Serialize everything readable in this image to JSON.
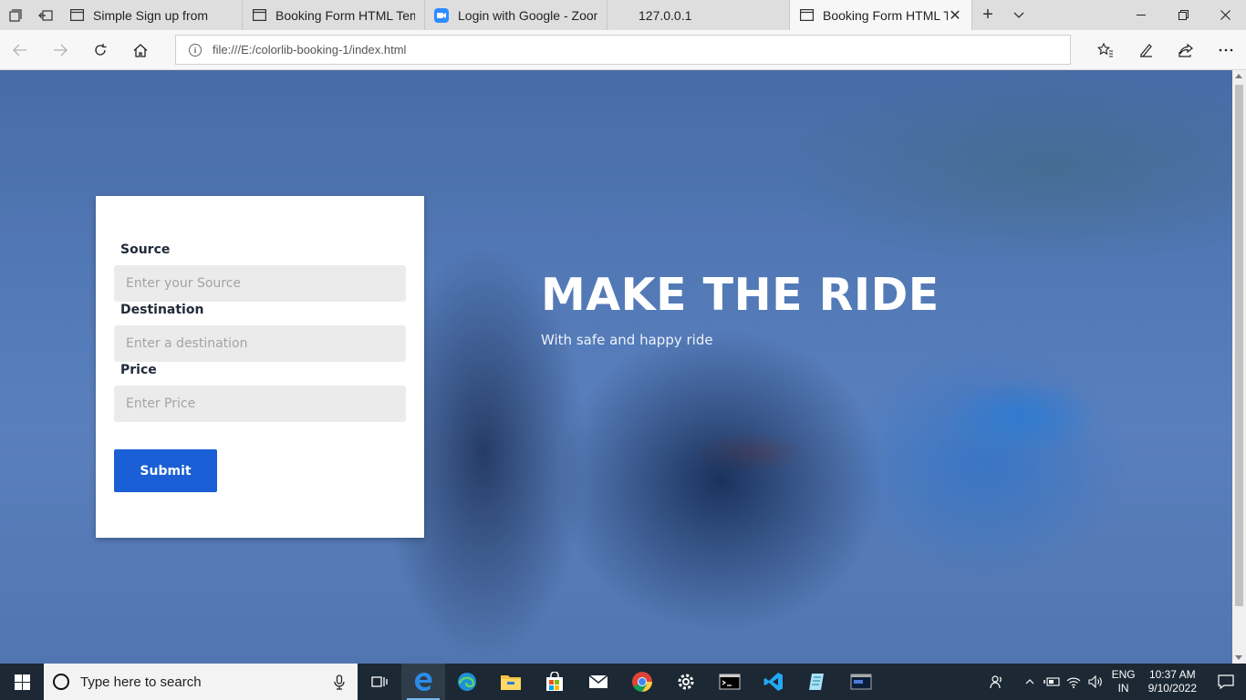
{
  "browser": {
    "tabs": [
      {
        "label": "Simple Sign up from",
        "icon": "page-icon"
      },
      {
        "label": "Booking Form HTML Templ",
        "icon": "page-icon"
      },
      {
        "label": "Login with Google - Zoom",
        "icon": "zoom-icon"
      },
      {
        "label": "127.0.0.1",
        "icon": "none"
      },
      {
        "label": "Booking Form HTML Te",
        "icon": "page-icon",
        "active": true
      }
    ],
    "url": "file:///E:/colorlib-booking-1/index.html"
  },
  "hero": {
    "title": "MAKE THE RIDE",
    "subtitle": "With safe and happy ride"
  },
  "form": {
    "source_label": "Source",
    "source_placeholder": "Enter your Source",
    "destination_label": "Destination",
    "destination_placeholder": "Enter a destination",
    "price_label": "Price",
    "price_placeholder": "Enter Price",
    "submit_label": "Submit"
  },
  "taskbar": {
    "search_placeholder": "Type here to search",
    "lang_line1": "ENG",
    "lang_line2": "IN",
    "time": "10:37 AM",
    "date": "9/10/2022"
  },
  "colors": {
    "submit": "#1a5fd6",
    "overlay": "#2f5fb4"
  }
}
